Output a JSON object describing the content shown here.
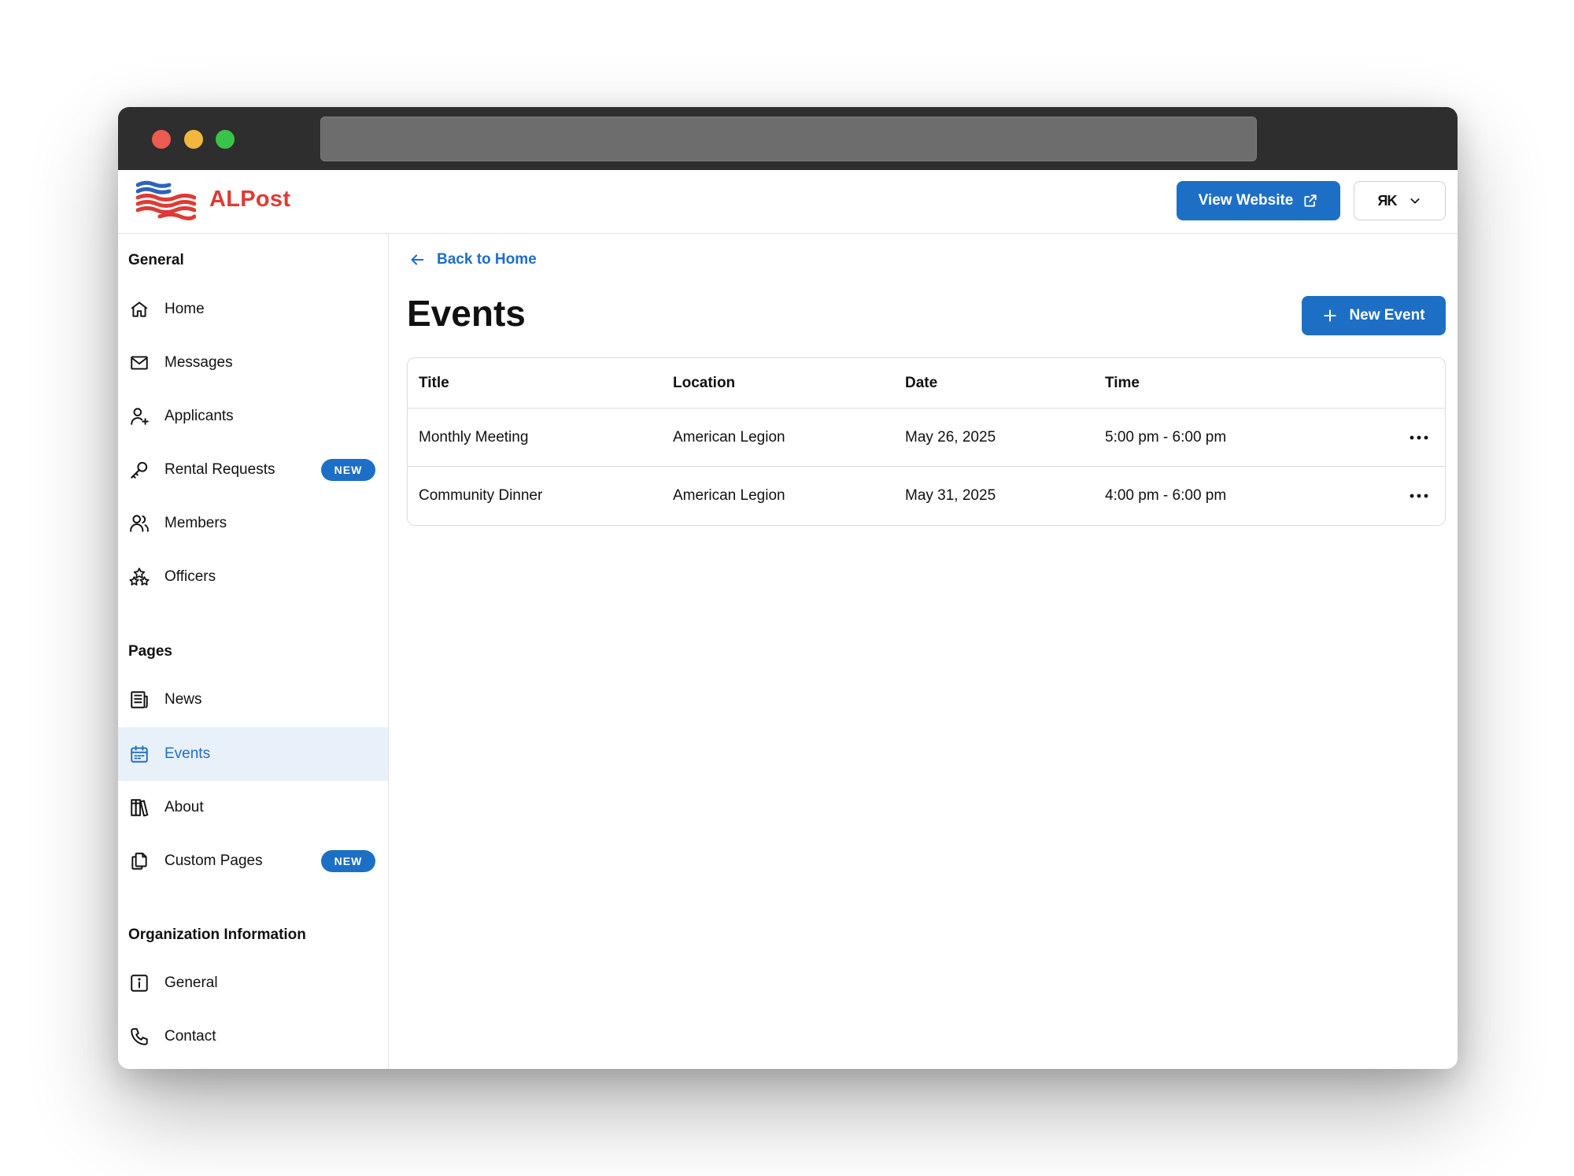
{
  "app": {
    "brand": "ALPost"
  },
  "header": {
    "view_website_label": "View Website",
    "account_initials": "ЯK"
  },
  "sidebar": {
    "sections": [
      {
        "title": "General",
        "items": [
          {
            "label": "Home",
            "icon": "home-icon"
          },
          {
            "label": "Messages",
            "icon": "mail-icon"
          },
          {
            "label": "Applicants",
            "icon": "user-plus-icon"
          },
          {
            "label": "Rental Requests",
            "icon": "key-icon",
            "badge": "NEW"
          },
          {
            "label": "Members",
            "icon": "users-icon"
          },
          {
            "label": "Officers",
            "icon": "stars-icon"
          }
        ]
      },
      {
        "title": "Pages",
        "items": [
          {
            "label": "News",
            "icon": "newspaper-icon"
          },
          {
            "label": "Events",
            "icon": "calendar-icon",
            "active": true
          },
          {
            "label": "About",
            "icon": "books-icon"
          },
          {
            "label": "Custom Pages",
            "icon": "documents-icon",
            "badge": "NEW"
          }
        ]
      },
      {
        "title": "Organization Information",
        "items": [
          {
            "label": "General",
            "icon": "info-icon"
          },
          {
            "label": "Contact",
            "icon": "phone-icon"
          }
        ]
      }
    ]
  },
  "main": {
    "back_label": "Back to Home",
    "title": "Events",
    "new_button_label": "New Event",
    "table": {
      "columns": [
        "Title",
        "Location",
        "Date",
        "Time"
      ],
      "rows": [
        [
          "Monthly Meeting",
          "American Legion",
          "May 26, 2025",
          "5:00 pm - 6:00 pm"
        ],
        [
          "Community Dinner",
          "American Legion",
          "May 31, 2025",
          "4:00 pm - 6:00 pm"
        ]
      ]
    }
  },
  "colors": {
    "accent": "#1d6fc6",
    "brand_red": "#df3a35",
    "active_bg": "#e8f0f9",
    "titlebar": "#2e2e2e"
  }
}
